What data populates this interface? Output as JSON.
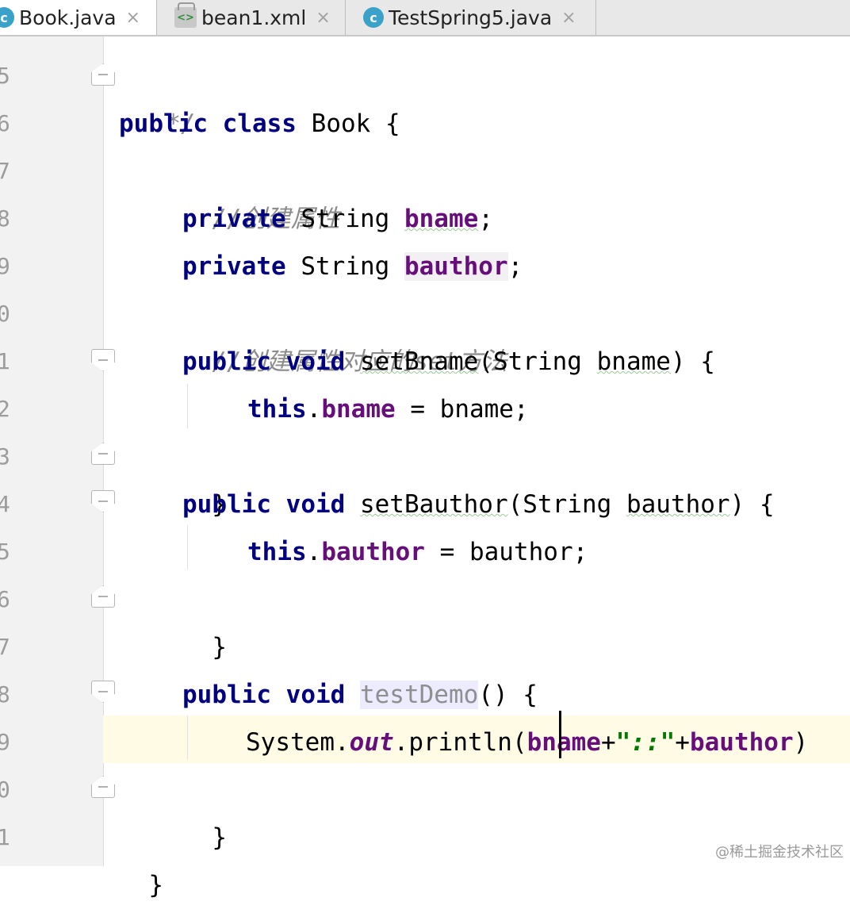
{
  "tabs": [
    {
      "label": "Book.java",
      "icon": "java-class-icon",
      "active": true
    },
    {
      "label": "bean1.xml",
      "icon": "xml-file-icon",
      "active": false
    },
    {
      "label": "TestSpring5.java",
      "icon": "java-class-icon",
      "active": false
    }
  ],
  "tab_close_glyph": "×",
  "tab_icon_glyphs": {
    "java": "c",
    "xml": "<>"
  },
  "line_numbers": [
    "5",
    "6",
    "7",
    "8",
    "9",
    "0",
    "1",
    "2",
    "3",
    "4",
    "5",
    "6",
    "7",
    "8",
    "9",
    "0",
    "1"
  ],
  "code": {
    "l5": {
      "comment": "*/"
    },
    "l6": {
      "kw1": "public",
      "kw2": "class",
      "name": "Book",
      "brace": "{"
    },
    "l7": {
      "comment": "//创建属性"
    },
    "l8": {
      "kw": "private",
      "type": "String",
      "field": "bname",
      "end": ";"
    },
    "l9": {
      "kw": "private",
      "type": "String",
      "field": "bauthor",
      "end": ";"
    },
    "l10": {
      "comment": "//创建属性对应的set方法"
    },
    "l11": {
      "kw1": "public",
      "kw2": "void",
      "method": "setBname",
      "open": "(",
      "ptype": "String",
      "pname": "bname",
      "close": ")",
      "brace": "{"
    },
    "l12": {
      "kw": "this",
      "dot": ".",
      "field": "bname",
      "assign": " = ",
      "value": "bname",
      "end": ";"
    },
    "l13": {
      "brace": "}"
    },
    "l14": {
      "kw1": "public",
      "kw2": "void",
      "method": "setBauthor",
      "open": "(",
      "ptype": "String",
      "pname": "bauthor",
      "close": ")",
      "brace": "{"
    },
    "l15": {
      "kw": "this",
      "dot": ".",
      "field": "bauthor",
      "assign": " = ",
      "value": "bauthor",
      "end": ";"
    },
    "l16": {
      "brace": "}"
    },
    "l18": {
      "kw1": "public",
      "kw2": "void",
      "method": "testDemo",
      "parens": "()",
      "brace": "{"
    },
    "l19": {
      "cls": "System",
      "dot": ".",
      "static_field": "out",
      "call": "println(",
      "arg1": "bname",
      "plus1": "+",
      "str": "\"::\"",
      "plus2": "+",
      "arg2": "bauthor",
      "close": ")"
    },
    "l20": {
      "brace": "}"
    },
    "l21": {
      "brace": "}"
    }
  },
  "watermark": "@稀土掘金技术社区"
}
